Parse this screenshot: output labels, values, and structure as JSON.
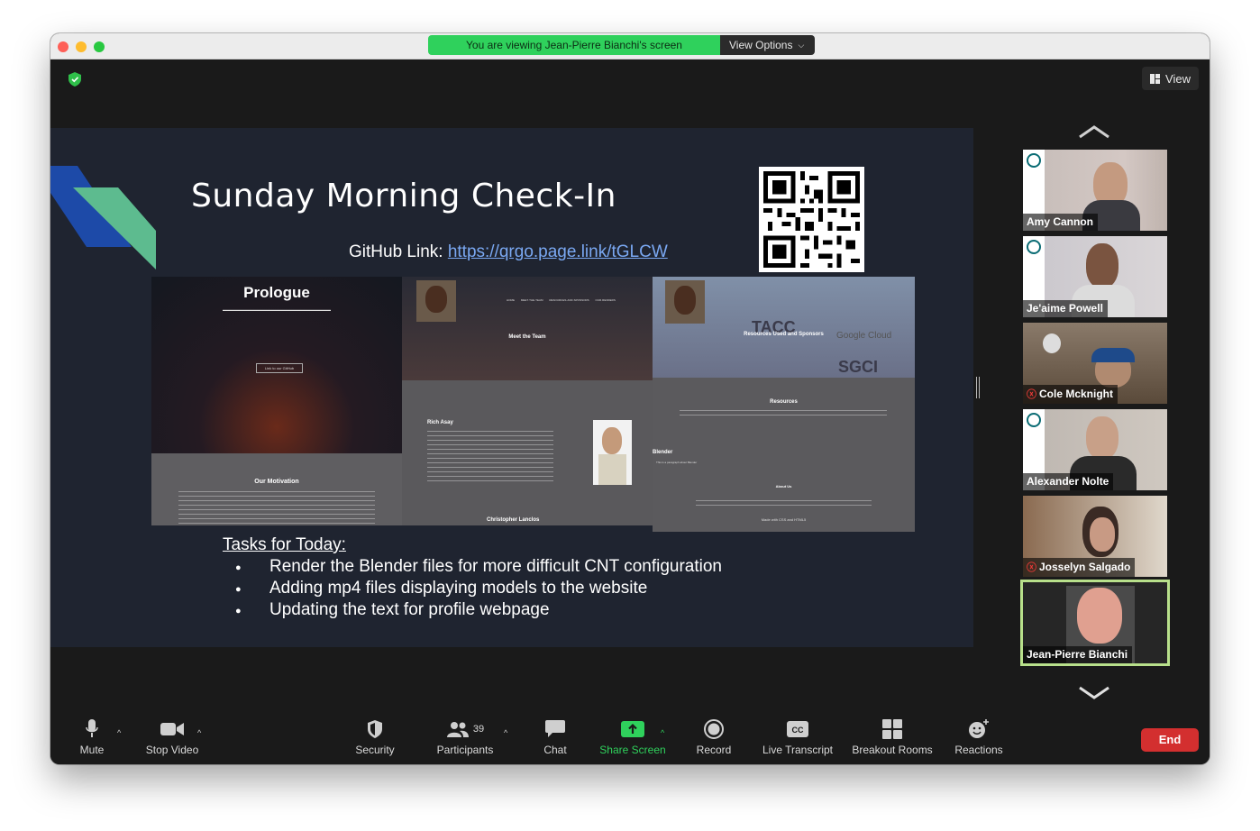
{
  "banner": {
    "message": "You are viewing Jean-Pierre Bianchi's screen",
    "view_options": "View Options"
  },
  "view_button": "View",
  "slide": {
    "title": "Sunday Morning Check-In",
    "github_prefix": "GitHub Link: ",
    "github_link": "https://qrgo.page.link/tGLCW",
    "tasks_heading": "Tasks for Today:",
    "tasks": [
      "Render the Blender files for more difficult CNT configuration",
      "Adding mp4 files displaying models to the website",
      "Updating the text for profile webpage"
    ],
    "website": {
      "prologue_title": "Prologue",
      "prologue_button": "Link to our GitHub",
      "motivation_title": "Our Motivation",
      "team_title": "Meet the Team",
      "member1": "Rich Asay",
      "member2": "Christopher Lanclos",
      "resources_used_title": "Resources Used and Sponsors",
      "resources_title": "Resources",
      "blender_title": "Blender",
      "blender_text": "This is a paragraph about Blender",
      "about_title": "About Us",
      "made_with": "Made with CSS and HTML5",
      "nav": [
        "HOME",
        "MEET THE TEAM",
        "RESOURCES AND SPONSORS",
        "OUR RENDERS"
      ],
      "logos": [
        "TACC",
        "Google Cloud",
        "SGCI"
      ]
    }
  },
  "participants_gallery": [
    {
      "name": "Amy Cannon",
      "muted": false,
      "active": false
    },
    {
      "name": "Je'aime Powell",
      "muted": false,
      "active": false
    },
    {
      "name": "Cole Mcknight",
      "muted": true,
      "active": false
    },
    {
      "name": "Alexander Nolte",
      "muted": false,
      "active": false
    },
    {
      "name": "Josselyn Salgado",
      "muted": true,
      "active": false
    },
    {
      "name": "Jean-Pierre Bianchi",
      "muted": false,
      "active": true
    }
  ],
  "toolbar": {
    "mute": "Mute",
    "stop_video": "Stop Video",
    "security": "Security",
    "participants": "Participants",
    "participants_count": "39",
    "chat": "Chat",
    "share_screen": "Share Screen",
    "record": "Record",
    "live_transcript": "Live Transcript",
    "breakout_rooms": "Breakout Rooms",
    "reactions": "Reactions",
    "end": "End"
  },
  "colors": {
    "share_green": "#2fd15c",
    "end_red": "#d32f2f",
    "active_speaker": "#b8e08b",
    "link_blue": "#7aa8f2"
  }
}
